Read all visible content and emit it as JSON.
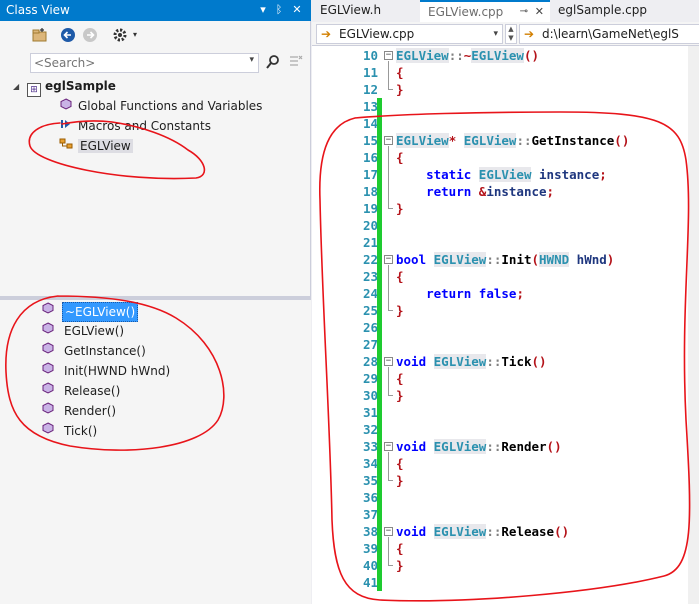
{
  "class_view": {
    "title": "Class View",
    "title_dropdown_glyph": "▾",
    "pin_glyph": "ᛒ",
    "close_glyph": "✕",
    "toolbar": {
      "new_folder_icon": "new-folder-icon",
      "back_icon": "back-icon",
      "forward_icon": "forward-icon",
      "settings_icon": "settings-icon"
    },
    "search_placeholder": "<Search>",
    "tree": {
      "project": "eglSample",
      "items": [
        {
          "label": "Global Functions and Variables",
          "icon": "global-functions-icon"
        },
        {
          "label": "Macros and Constants",
          "icon": "macros-icon"
        },
        {
          "label": "EGLView",
          "icon": "class-icon"
        }
      ]
    },
    "members": [
      {
        "label": "~EGLView()",
        "selected": true
      },
      {
        "label": "EGLView()",
        "selected": false
      },
      {
        "label": "GetInstance()",
        "selected": false
      },
      {
        "label": "Init(HWND hWnd)",
        "selected": false
      },
      {
        "label": "Release()",
        "selected": false
      },
      {
        "label": "Render()",
        "selected": false
      },
      {
        "label": "Tick()",
        "selected": false
      }
    ]
  },
  "editor": {
    "tabs": [
      {
        "label": "EGLView.h",
        "active": false
      },
      {
        "label": "EGLView.cpp",
        "active": true
      },
      {
        "label": "eglSample.cpp",
        "active": false
      }
    ],
    "nav": {
      "file_scope": "EGLView.cpp",
      "path": "d:\\learn\\GameNet\\eglS"
    },
    "line_numbers": [
      "10",
      "11",
      "12",
      "13",
      "14",
      "15",
      "16",
      "17",
      "18",
      "19",
      "20",
      "21",
      "22",
      "23",
      "24",
      "25",
      "26",
      "27",
      "28",
      "29",
      "30",
      "31",
      "32",
      "33",
      "34",
      "35",
      "36",
      "37",
      "38",
      "39",
      "40",
      "41"
    ],
    "code_text": [
      "EGLView::~EGLView()",
      "{",
      "}",
      "",
      "",
      "EGLView* EGLView::GetInstance()",
      "{",
      "    static EGLView instance;",
      "    return &instance;",
      "}",
      "",
      "",
      "bool EGLView::Init(HWND hWnd)",
      "{",
      "    return false;",
      "}",
      "",
      "",
      "void EGLView::Tick()",
      "{",
      "}",
      "",
      "",
      "void EGLView::Render()",
      "{",
      "}",
      "",
      "",
      "void EGLView::Release()",
      "{",
      "}",
      ""
    ]
  },
  "colors": {
    "accent": "#007acc",
    "annotation": "#e8141a",
    "change_bar": "#1ecb30",
    "selection": "#3399ff",
    "keyword": "#0000ff",
    "type": "#2b91af"
  }
}
